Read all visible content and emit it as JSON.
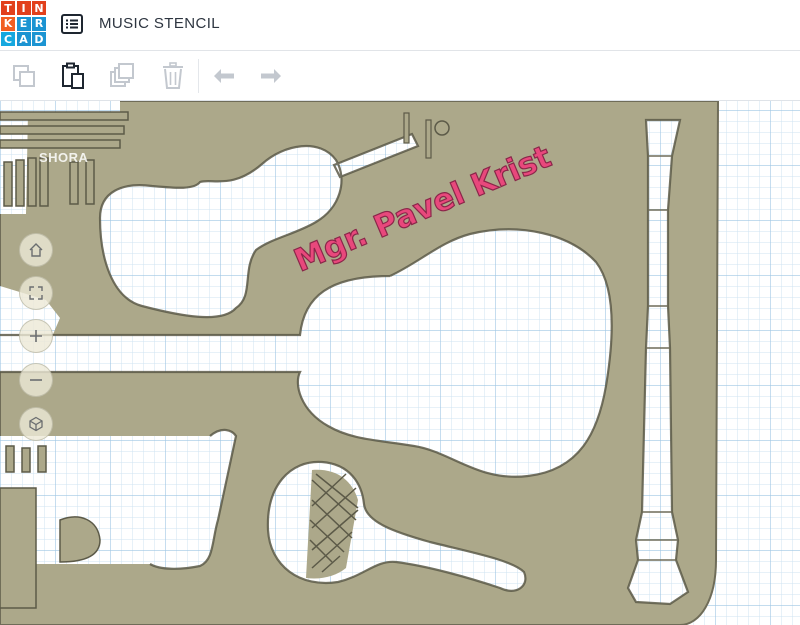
{
  "app": {
    "logo_letters": [
      "T",
      "I",
      "N",
      "K",
      "E",
      "R",
      "C",
      "A",
      "D"
    ],
    "logo_colors": [
      "#e2401c",
      "#e2401c",
      "#e2401c",
      "#f15e22",
      "#1c94d2",
      "#1c94d2",
      "#16a8df",
      "#1c94d2",
      "#1c94d2"
    ],
    "title": "MUSIC STENCIL"
  },
  "header": {
    "design_list_icon": "list-icon"
  },
  "toolbar": {
    "buttons": [
      {
        "name": "copy",
        "icon": "copy-icon",
        "enabled": false
      },
      {
        "name": "paste",
        "icon": "paste-icon",
        "enabled": true
      },
      {
        "name": "duplicate",
        "icon": "duplicate-icon",
        "enabled": false
      },
      {
        "name": "delete",
        "icon": "trash-icon",
        "enabled": false
      },
      {
        "name": "undo",
        "icon": "undo-icon",
        "enabled": false
      },
      {
        "name": "redo",
        "icon": "redo-icon",
        "enabled": false
      }
    ]
  },
  "viewport": {
    "engraved_text": "Mgr. Pavel Krist",
    "watermark": "SHORA",
    "colors": {
      "stencil": "#aca88a",
      "stencil_edge": "#6f6c58",
      "engraving": "#e8487c",
      "grid_minor": "#cfe3f2",
      "grid_major": "#9fc6e4"
    }
  },
  "view_controls": [
    {
      "name": "home",
      "icon": "home-icon"
    },
    {
      "name": "fit",
      "icon": "fit-view-icon"
    },
    {
      "name": "zoom-in",
      "icon": "plus-icon"
    },
    {
      "name": "zoom-out",
      "icon": "minus-icon"
    },
    {
      "name": "orthographic",
      "icon": "cube-icon"
    }
  ]
}
